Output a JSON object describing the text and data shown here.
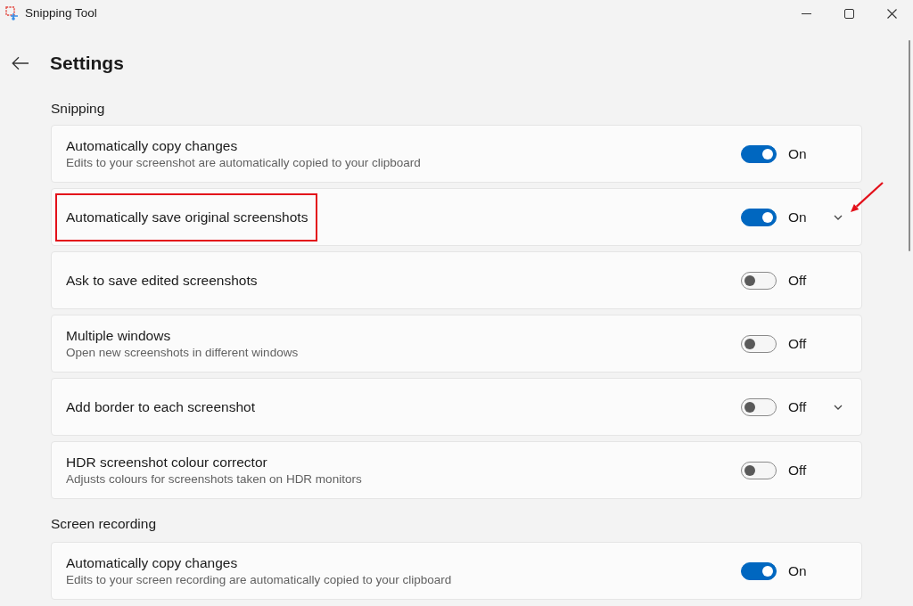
{
  "window": {
    "title": "Snipping Tool"
  },
  "page_title": "Settings",
  "sections": [
    {
      "title": "Snipping",
      "settings": [
        {
          "title": "Automatically copy changes",
          "description": "Edits to your screenshot are automatically copied to your clipboard",
          "on": true,
          "state_label": "On",
          "expandable": false,
          "highlighted": false,
          "arrow": false
        },
        {
          "title": "Automatically save original screenshots",
          "on": true,
          "state_label": "On",
          "expandable": true,
          "highlighted": true,
          "arrow": true
        },
        {
          "title": "Ask to save edited screenshots",
          "on": false,
          "state_label": "Off",
          "expandable": false,
          "highlighted": false,
          "arrow": false
        },
        {
          "title": "Multiple windows",
          "description": "Open new screenshots in different windows",
          "on": false,
          "state_label": "Off",
          "expandable": false,
          "highlighted": false,
          "arrow": false
        },
        {
          "title": "Add border to each screenshot",
          "on": false,
          "state_label": "Off",
          "expandable": true,
          "highlighted": false,
          "arrow": false
        },
        {
          "title": "HDR screenshot colour corrector",
          "description": "Adjusts colours for screenshots taken on HDR monitors",
          "on": false,
          "state_label": "Off",
          "expandable": false,
          "highlighted": false,
          "arrow": false
        }
      ]
    },
    {
      "title": "Screen recording",
      "settings": [
        {
          "title": "Automatically copy changes",
          "description": "Edits to your screen recording are automatically copied to your clipboard",
          "on": true,
          "state_label": "On",
          "expandable": false,
          "highlighted": false,
          "arrow": false
        }
      ]
    }
  ]
}
